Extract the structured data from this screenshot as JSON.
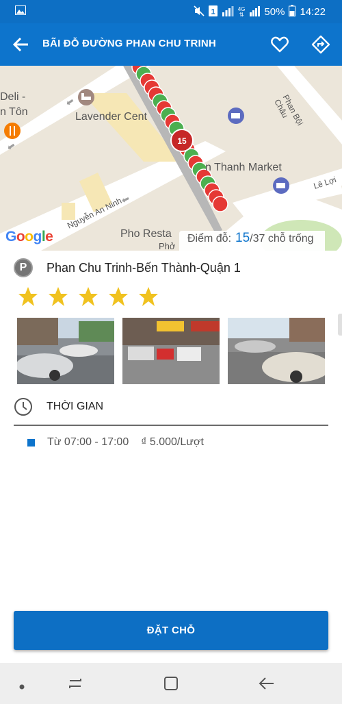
{
  "status_bar": {
    "battery": "50%",
    "time": "14:22",
    "network": "4G",
    "sim": "1"
  },
  "app_bar": {
    "title": "BÃI ĐỖ ĐƯỜNG PHAN CHU TRINH"
  },
  "map": {
    "labels": {
      "deli": "Deli -",
      "ton": "n Tôn",
      "lavender": "Lavender Cent",
      "market": "n Thanh Market",
      "pho": "Pho Resta",
      "pho2": "Phở",
      "phan_boi_chau": "Phan Bội Châu",
      "le_loi": "Lê Lợi",
      "nguyen_an_ninh": "Nguyễn An Ninh",
      "google": "Google"
    },
    "marker_number": "15",
    "spots_label": "Điểm đỗ:",
    "spots_available": "15",
    "spots_total_suffix": "/37 chỗ trống"
  },
  "place": {
    "name": "Phan Chu Trinh-Bến Thành-Quận 1",
    "rating": 5,
    "rating_max": 5,
    "photo_count": 3
  },
  "time_section": {
    "title": "THỜI GIAN",
    "schedule": "Từ 07:00 - 17:00",
    "price": "₫ 5.000/Lượt"
  },
  "book_button": {
    "label": "ĐẶT CHỖ"
  },
  "colors": {
    "primary": "#0d74cc",
    "star": "#f0c21f",
    "spot_free": "#4caf50",
    "spot_taken": "#e53935"
  }
}
